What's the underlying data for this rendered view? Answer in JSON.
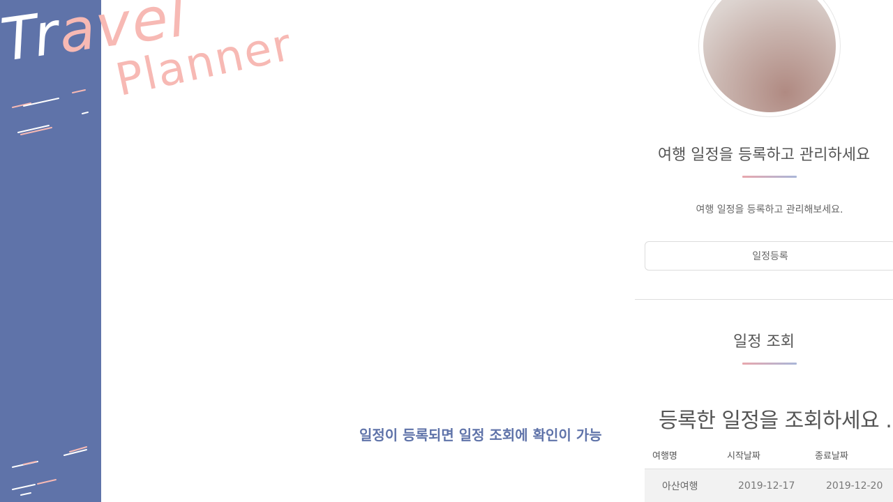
{
  "logo": {
    "part1": "Tr",
    "part2": "avel",
    "part3": "Planner"
  },
  "caption": "일정이 등록되면 일정 조회에 확인이 가능",
  "register": {
    "title": "여행 일정을 등록하고 관리하세요",
    "subtitle": "여행 일정을 등록하고 관리해보세요.",
    "button_label": "일정등록"
  },
  "lookup": {
    "title": "일정 조회",
    "heading": "등록한 일정을 조회하세요 .",
    "columns": [
      "여행명",
      "시작날짜",
      "종료날짜"
    ],
    "rows": [
      {
        "name": "아산여행",
        "start": "2019-12-17",
        "end": "2019-12-20"
      }
    ]
  },
  "colors": {
    "sidebar": "#5f73a9",
    "accent_pink": "#f7b9b4",
    "caption": "#5f73a9"
  }
}
